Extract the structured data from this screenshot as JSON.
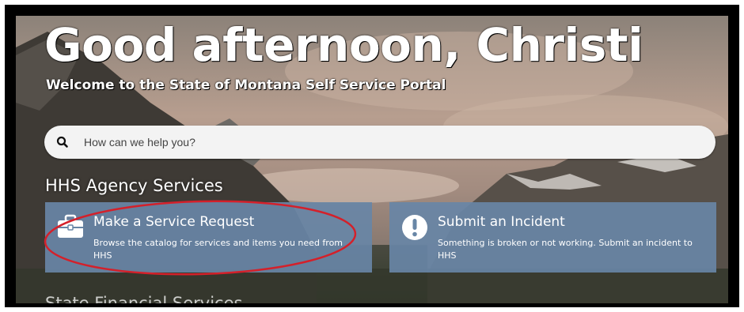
{
  "greeting": "Good afternoon, Christi",
  "welcome": "Welcome to the State of Montana Self Service Portal",
  "search": {
    "placeholder": "How can we help you?",
    "icon": "search-icon"
  },
  "section_title": "HHS Agency Services",
  "cards": [
    {
      "title": "Make a Service Request",
      "description": "Browse the catalog for services and items you need from HHS",
      "icon": "briefcase-icon"
    },
    {
      "title": "Submit an Incident",
      "description": "Something is broken or not working. Submit an incident to HHS",
      "icon": "exclamation-icon"
    }
  ],
  "next_section_title": "State Financial Services",
  "colors": {
    "card": "#6886a6",
    "annotation": "#d4202a",
    "frame": "#000000"
  }
}
